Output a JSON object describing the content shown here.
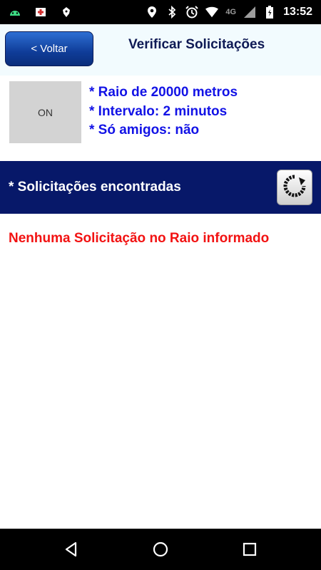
{
  "status_bar": {
    "time": "13:52",
    "network": "4G",
    "left_icons": [
      "android-icon",
      "first-aid-icon",
      "debug-icon"
    ],
    "right_icons": [
      "location-icon",
      "bluetooth-icon",
      "alarm-icon",
      "wifi-icon",
      "signal-icon",
      "battery-icon"
    ]
  },
  "header": {
    "back_label": "< Voltar",
    "title": "Verificar Solicitações"
  },
  "controls": {
    "toggle_label": "ON"
  },
  "info": {
    "radius": "* Raio de 20000 metros",
    "interval": "* Intervalo: 2 minutos",
    "friends_only": "* Só amigos: não"
  },
  "results": {
    "title": "* Solicitações encontradas",
    "empty_message": "Nenhuma Solicitação no Raio informado"
  },
  "nav": {
    "buttons": [
      "back-icon",
      "home-icon",
      "recents-icon"
    ]
  },
  "colors": {
    "header_bg": "#f2fbfe",
    "accent_blue": "#1212e6",
    "band_navy": "#071869",
    "error_red": "#f21212",
    "back_button_blue": "#1f56b8"
  }
}
